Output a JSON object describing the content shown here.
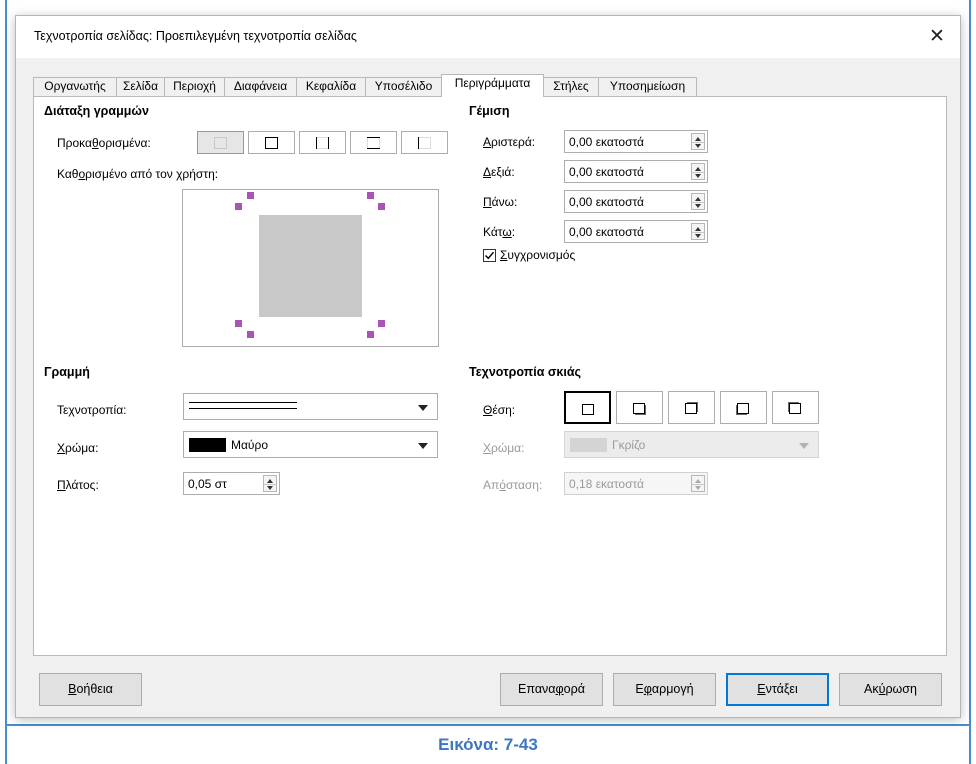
{
  "window": {
    "title": "Τεχνοτροπία σελίδας: Προεπιλεγμένη τεχνοτροπία σελίδας"
  },
  "tabs": [
    {
      "label": "Οργανωτής"
    },
    {
      "label": "Σελίδα"
    },
    {
      "label": "Περιοχή"
    },
    {
      "label": "Διαφάνεια"
    },
    {
      "label": "Κεφαλίδα"
    },
    {
      "label": "Υποσέλιδο"
    },
    {
      "label": "Περιγράμματα"
    },
    {
      "label": "Στήλες"
    },
    {
      "label": "Υποσημείωση"
    }
  ],
  "active_tab": "Περιγράμματα",
  "line_arrangement": {
    "title": "Διάταξη γραμμών",
    "presets_label_pre": "Προκα",
    "presets_label_key": "θ",
    "presets_label_post": "ορισμένα:",
    "user_defined_pre": "Καθ",
    "user_defined_key": "ο",
    "user_defined_post": "ρισμένο από τον χρήστη:",
    "preview_fill_color": "#c8c8c8",
    "handle_color": "#a855b5"
  },
  "padding": {
    "title": "Γέμιση",
    "left_key": "Α",
    "left_rest": "ριστερά:",
    "left_value": "0,00 εκατοστά",
    "right_key": "Δ",
    "right_rest": "εξιά:",
    "right_value": "0,00 εκατοστά",
    "top_key": "Π",
    "top_rest": "άνω:",
    "top_value": "0,00 εκατοστά",
    "bottom_pre": "Κάτ",
    "bottom_key": "ω",
    "bottom_post": ":",
    "bottom_value": "0,00 εκατοστά",
    "sync_key": "Σ",
    "sync_rest": "υγχρονισμός",
    "sync_checked": true
  },
  "line": {
    "title": "Γραμμή",
    "style_pre": "Τε",
    "style_key": "χ",
    "style_post": "νοτροπία:",
    "color_key": "Χ",
    "color_rest": "ρώμα:",
    "color_value": "Μαύρο",
    "color_swatch": "#000000",
    "width_key": "Π",
    "width_rest": "λάτος:",
    "width_value": "0,05 στ"
  },
  "shadow": {
    "title": "Τεχνοτροπία σκιάς",
    "position_key": "Θ",
    "position_rest": "έση:",
    "color_key": "Χ",
    "color_rest": "ρώμα:",
    "color_value": "Γκρίζο",
    "color_swatch": "#c8c8c8",
    "distance_pre": "Απ",
    "distance_key": "ό",
    "distance_post": "σταση:",
    "distance_value": "0,18 εκατοστά"
  },
  "buttons": {
    "help_key": "Β",
    "help_rest": "οήθεια",
    "reset_pre": "Επανα",
    "reset_key": "φ",
    "reset_post": "ορά",
    "apply_pre": "Ε",
    "apply_key": "φ",
    "apply_post": "αρμογή",
    "ok_key": "Ε",
    "ok_rest": "ντάξει",
    "cancel_pre": "Ακ",
    "cancel_key": "ύ",
    "cancel_post": "ρωση"
  },
  "caption": "Εικόνα: 7-43"
}
